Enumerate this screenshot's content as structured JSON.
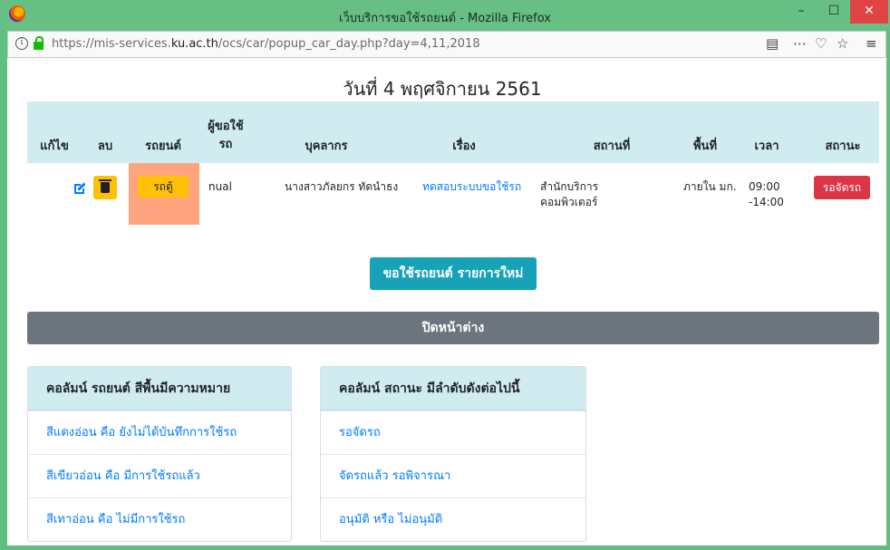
{
  "window": {
    "title": "เว็บบริการขอใช้รถยนต์ - Mozilla Firefox",
    "min": "–",
    "max": "☐",
    "close": "✕"
  },
  "urlbar": {
    "prefix": "https://mis-services.",
    "domain": "ku.ac.th",
    "path": "/ocs/car/popup_car_day.php?day=4,11,2018"
  },
  "page": {
    "title": "วันที่ 4 พฤศจิกายน 2561"
  },
  "table": {
    "headers": {
      "edit": "แก้ไข",
      "delete": "ลบ",
      "car": "รถยนต์",
      "requester": "ผู้ขอใช้รถ",
      "person": "บุคลากร",
      "subject": "เรื่อง",
      "place": "สถานที่",
      "area": "พื้นที่",
      "time": "เวลา",
      "status": "สถานะ"
    },
    "row": {
      "car": "รถตู้",
      "requester": "nual",
      "person": "นางสาวภัลยกร ทัดนำธง",
      "subject": "ทดสอบระบบขอใช้รถ",
      "place": "สำนักบริการคอมพิวเตอร์",
      "area": "ภายใน มก.",
      "time": "09:00 -14:00",
      "status": "รอจัดรถ"
    }
  },
  "buttons": {
    "new_request": "ขอใช้รถยนต์ รายการใหม่",
    "close_window": "ปิดหน้าต่าง"
  },
  "legend_car": {
    "title": "คอลัมน์ รถยนต์ สีพื้นมีความหมาย",
    "items": [
      "สีแดงอ่อน คือ ยังไม่ได้บันทึกการใช้รถ",
      "สีเขียวอ่อน คือ มีการใช้รถแล้ว",
      "สีเทาอ่อน คือ ไม่มีการใช้รถ"
    ]
  },
  "legend_status": {
    "title": "คอลัมน์ สถานะ มีลำดับดังต่อไปนี้",
    "items": [
      "รอจัดรถ",
      "จัดรถแล้ว รอพิจารณา",
      "อนุมัติ หรือ ไม่อนุมัติ"
    ]
  },
  "colors": {
    "header_bg": "#d1ecf1",
    "car_cell_bg": "#ffa47e",
    "status_badge": "#dc3545",
    "primary_button": "#17a2b8"
  }
}
